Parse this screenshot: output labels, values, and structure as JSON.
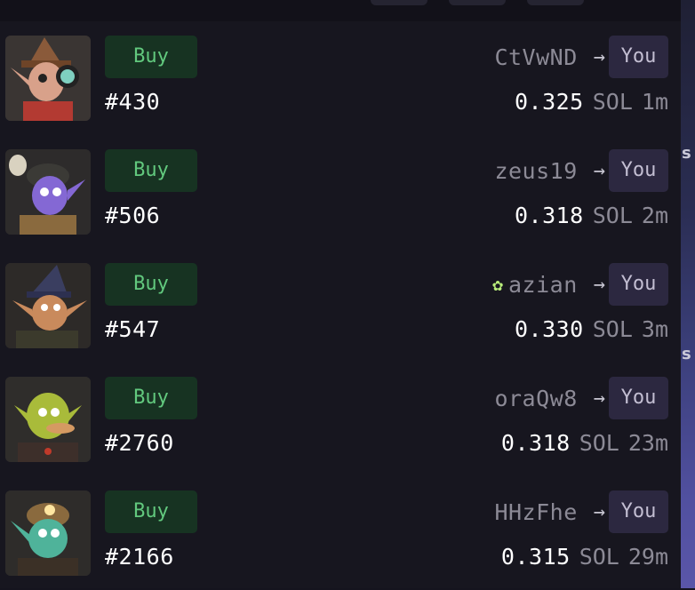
{
  "listings": [
    {
      "buy_label": "Buy",
      "token": "#430",
      "from": "CtVwND",
      "to": "You",
      "price": "0.325",
      "unit": "SOL",
      "age": "1m",
      "verified_icon": false,
      "avatar": "gnome-with-goggles-and-pointed-hat"
    },
    {
      "buy_label": "Buy",
      "token": "#506",
      "from": "zeus19",
      "to": "You",
      "price": "0.318",
      "unit": "SOL",
      "age": "2m",
      "verified_icon": false,
      "avatar": "purple-goblin-with-skull-helmet"
    },
    {
      "buy_label": "Buy",
      "token": "#547",
      "from": "azian",
      "to": "You",
      "price": "0.330",
      "unit": "SOL",
      "age": "3m",
      "verified_icon": true,
      "avatar": "goblin-with-wizard-hat"
    },
    {
      "buy_label": "Buy",
      "token": "#2760",
      "from": "oraQw8",
      "to": "You",
      "price": "0.318",
      "unit": "SOL",
      "age": "23m",
      "verified_icon": false,
      "avatar": "green-goblin-with-big-nose"
    },
    {
      "buy_label": "Buy",
      "token": "#2166",
      "from": "HHzFhe",
      "to": "You",
      "price": "0.315",
      "unit": "SOL",
      "age": "29m",
      "verified_icon": false,
      "avatar": "teal-goblin-with-miner-helmet"
    }
  ],
  "edge_letters": [
    "s",
    "s"
  ],
  "colors": {
    "buy_bg": "#173322",
    "buy_text": "#62c97e",
    "you_bg": "#2c2840",
    "verified": "#b8ec7a"
  }
}
